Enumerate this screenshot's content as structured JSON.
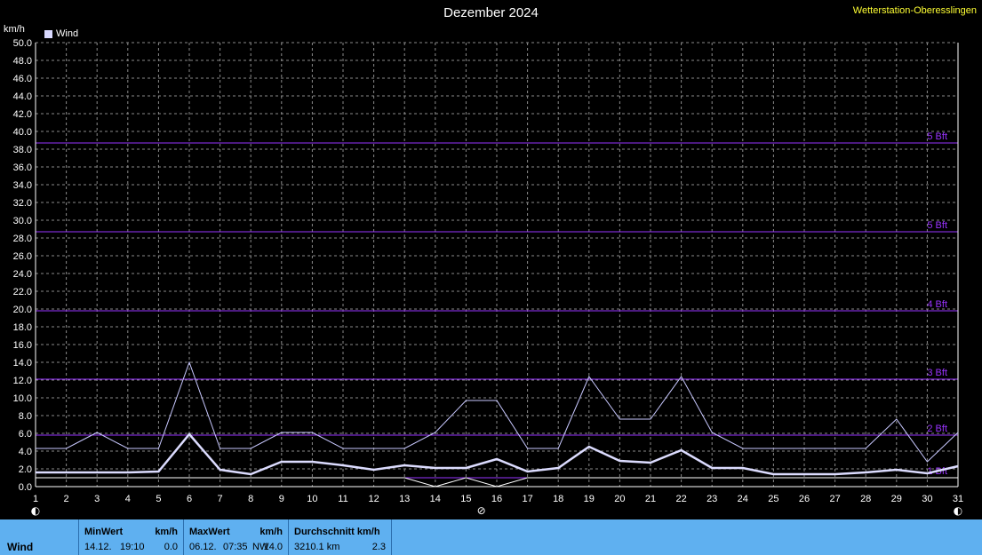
{
  "header": {
    "title": "Dezember 2024",
    "station": "Wetterstation-Oberesslingen",
    "unit": "km/h",
    "legend_label": "Wind"
  },
  "chart_data": {
    "type": "line",
    "title": "Dezember 2024",
    "ylabel": "km/h",
    "ylim": [
      0,
      50
    ],
    "xlim": [
      1,
      31
    ],
    "x": [
      1,
      2,
      3,
      4,
      5,
      6,
      7,
      8,
      9,
      10,
      11,
      12,
      13,
      14,
      15,
      16,
      17,
      18,
      19,
      20,
      21,
      22,
      23,
      24,
      25,
      26,
      27,
      28,
      29,
      30,
      31
    ],
    "y_ticks": [
      "0.0",
      "2.0",
      "4.0",
      "6.0",
      "8.0",
      "10.0",
      "12.0",
      "14.0",
      "16.0",
      "18.0",
      "20.0",
      "22.0",
      "24.0",
      "26.0",
      "28.0",
      "30.0",
      "32.0",
      "34.0",
      "36.0",
      "38.0",
      "40.0",
      "42.0",
      "44.0",
      "46.0",
      "48.0",
      "50.0"
    ],
    "x_ticks": [
      "1",
      "2",
      "3",
      "4",
      "5",
      "6",
      "7",
      "8",
      "9",
      "10",
      "11",
      "12",
      "13",
      "14",
      "15",
      "16",
      "17",
      "18",
      "19",
      "20",
      "21",
      "22",
      "23",
      "24",
      "25",
      "26",
      "27",
      "28",
      "29",
      "30",
      "31"
    ],
    "grid": true,
    "legend": "top-left",
    "series": [
      {
        "name": "Wind",
        "role": "max",
        "color": "#c8c8ff",
        "values": [
          4.3,
          4.3,
          6.1,
          4.3,
          4.3,
          14.0,
          4.3,
          4.3,
          6.1,
          6.1,
          4.3,
          4.3,
          4.3,
          6.1,
          9.7,
          9.7,
          4.3,
          4.3,
          12.4,
          7.6,
          7.6,
          12.4,
          6.1,
          4.3,
          4.3,
          4.3,
          4.3,
          4.3,
          7.6,
          2.8,
          6.1
        ]
      },
      {
        "role": "avg",
        "color": "#dcdcff",
        "values": [
          1.6,
          1.6,
          1.6,
          1.6,
          1.7,
          5.9,
          1.9,
          1.4,
          2.8,
          2.8,
          2.4,
          1.9,
          2.4,
          2.1,
          2.1,
          3.1,
          1.7,
          2.1,
          4.5,
          2.9,
          2.7,
          4.1,
          2.1,
          2.1,
          1.4,
          1.4,
          1.4,
          1.6,
          1.9,
          1.5,
          2.3
        ]
      },
      {
        "role": "min",
        "color": "#ffffff",
        "values": [
          1.0,
          1.0,
          1.0,
          1.0,
          1.0,
          1.0,
          1.0,
          1.0,
          1.0,
          1.0,
          1.0,
          1.0,
          1.0,
          0.0,
          1.0,
          0.0,
          1.0,
          1.0,
          1.0,
          1.0,
          1.0,
          1.0,
          1.0,
          1.0,
          1.0,
          1.0,
          1.0,
          1.0,
          1.0,
          1.0,
          1.0
        ]
      }
    ],
    "beaufort_lines": [
      {
        "value": 38.7,
        "label": "5 Bft"
      },
      {
        "value": 28.7,
        "label": "5 Bft"
      },
      {
        "value": 19.8,
        "label": "4 Bft"
      },
      {
        "value": 12.1,
        "label": "3 Bft"
      },
      {
        "value": 5.8,
        "label": "2 Bft"
      },
      {
        "value": 1.0,
        "label": "1 Bft"
      }
    ],
    "beaufort_color": "#9933ff",
    "moon_markers": [
      {
        "day": 1,
        "glyph": "◐"
      },
      {
        "day": 15.5,
        "glyph": "⊘"
      },
      {
        "day": 31,
        "glyph": "◐"
      }
    ]
  },
  "footer": {
    "row_label": "Wind",
    "min": {
      "header": "MinWert",
      "unit": "km/h",
      "date": "14.12.",
      "time": "19:10",
      "value": "0.0"
    },
    "max": {
      "header": "MaxWert",
      "unit": "km/h",
      "date": "06.12.",
      "time": "07:35",
      "dir": "NW",
      "value": "14.0"
    },
    "avg": {
      "header": "Durchschnitt km/h",
      "distance": "3210.1 km",
      "value": "2.3"
    }
  }
}
